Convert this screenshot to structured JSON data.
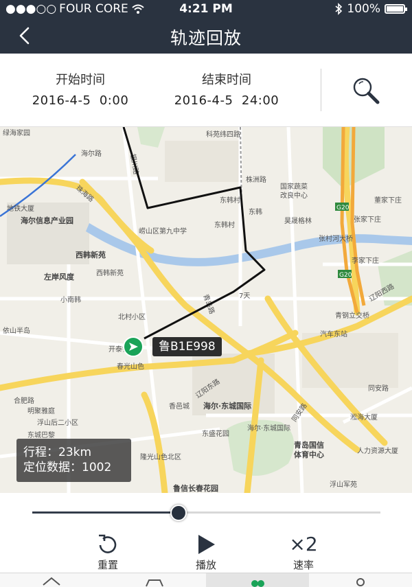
{
  "status_bar": {
    "carrier": "FOUR CORE",
    "time": "4:21 PM",
    "battery": "100%",
    "battery_level_pct": 100
  },
  "nav": {
    "title": "轨迹回放",
    "back_icon": "chevron-left-icon"
  },
  "time_range": {
    "start_label": "开始时间",
    "start_value": "2016-4-5  0:00",
    "end_label": "结束时间",
    "end_value": "2016-4-5  24:00",
    "search_icon": "search-icon"
  },
  "map": {
    "labels": [
      "绿海家园",
      "海尔路",
      "地铁大厦",
      "海尔信息产业园",
      "珠海路",
      "西韩新苑",
      "西韩新苑",
      "左岸风度",
      "小南韩",
      "北村小区",
      "依山半岛",
      "开泰锦城",
      "春光山色",
      "合肥路",
      "明聚雅庭",
      "浮山后二小区",
      "东城巴黎",
      "崂山区第九中学",
      "东韩",
      "东韩村",
      "东韩村",
      "国家蔬菜",
      "改良中心",
      "昊晟格林",
      "张村河大桥",
      "张家下庄",
      "李家下庄",
      "董家下庄",
      "青钢立交桥",
      "汽车东站",
      "同安路",
      "辽阳东路",
      "海尔·东城国际",
      "香邑城",
      "青岛国信",
      "体育中心",
      "海尔·东城国际",
      "东盛花园",
      "隆光山色北区",
      "鲁信长春花园",
      "人力资源大厦",
      "浮山军苑",
      "淞海大厦",
      "7天",
      "G20",
      "G20",
      "科苑纬四路",
      "株洲路",
      "辽阳西路",
      "同安路",
      "青岛路",
      "银川路"
    ]
  },
  "vehicle": {
    "plate": "鲁B1E998",
    "marker_icon": "vehicle-arrow-icon"
  },
  "stats": {
    "distance": "行程：23km",
    "points": "定位数据：1002"
  },
  "playback": {
    "progress_fraction": 0.42
  },
  "controls": {
    "reset_label": "重置",
    "play_label": "播放",
    "speed_value": "×2",
    "speed_label": "速率"
  },
  "tabs": [
    {
      "icon": "home-icon"
    },
    {
      "icon": "car-icon"
    },
    {
      "icon": "users-icon"
    },
    {
      "icon": "user-icon"
    }
  ],
  "colors": {
    "header_bg": "#2a3340",
    "accent": "#27303d",
    "marker": "#1aa358",
    "track": "#111111"
  }
}
